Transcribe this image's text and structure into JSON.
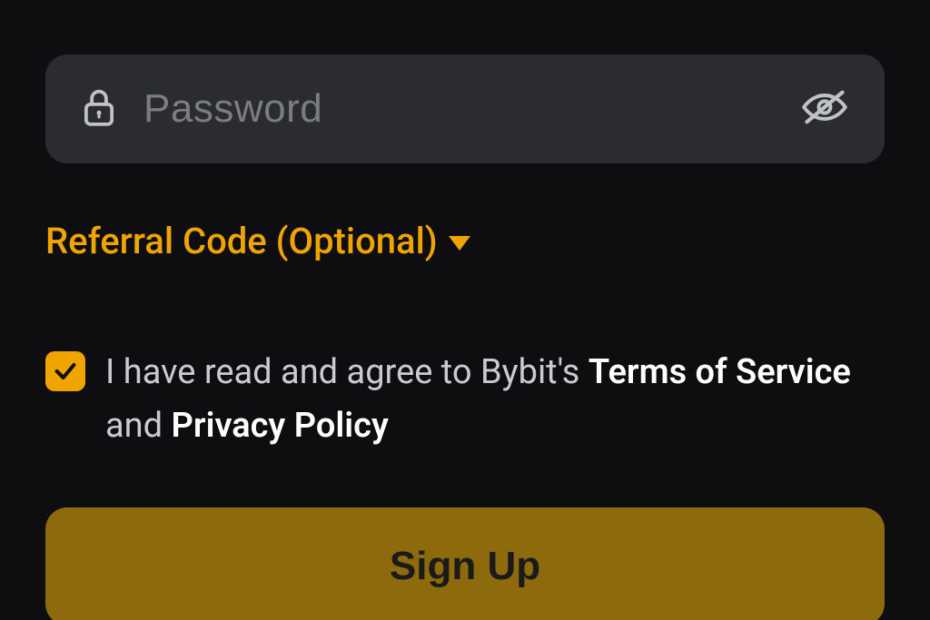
{
  "password": {
    "placeholder": "Password",
    "value": ""
  },
  "referral": {
    "label": "Referral Code (Optional)"
  },
  "agreement": {
    "checked": true,
    "pre": "I have read and agree to Bybit's ",
    "tos": "Terms of Service",
    "mid": " and ",
    "privacy": "Privacy Policy"
  },
  "button": {
    "signup": "Sign Up"
  },
  "colors": {
    "accent": "#f0a400",
    "button": "#8d6a0b",
    "field_bg": "#2a2c30",
    "bg": "#0e0e11"
  }
}
